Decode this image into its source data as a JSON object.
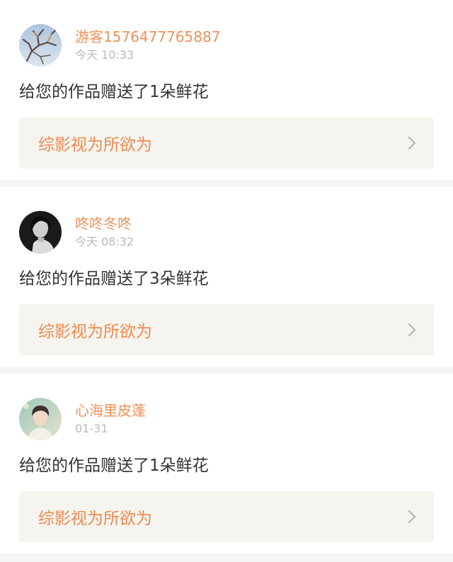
{
  "messages": [
    {
      "username": "游客1576477765887",
      "time": "今天 10:33",
      "text": "给您的作品赠送了1朵鲜花",
      "work_title": "综影视为所欲为",
      "avatar_icon": "tree-branch-avatar",
      "chevron_icon": "chevron-right-icon"
    },
    {
      "username": "咚咚冬咚",
      "time": "今天 08:32",
      "text": "给您的作品赠送了3朵鲜花",
      "work_title": "综影视为所欲为",
      "avatar_icon": "bw-portrait-avatar",
      "chevron_icon": "chevron-right-icon"
    },
    {
      "username": "心海里皮蓬",
      "time": "01-31",
      "text": "给您的作品赠送了1朵鲜花",
      "work_title": "综影视为所欲为",
      "avatar_icon": "portrait-avatar",
      "chevron_icon": "chevron-right-icon"
    }
  ],
  "colors": {
    "username": "#f0905a",
    "work_title": "#ee8a52",
    "work_bg": "#f5f4ee",
    "timestamp": "#b9b9b9",
    "page_bg": "#f6f5f3"
  }
}
